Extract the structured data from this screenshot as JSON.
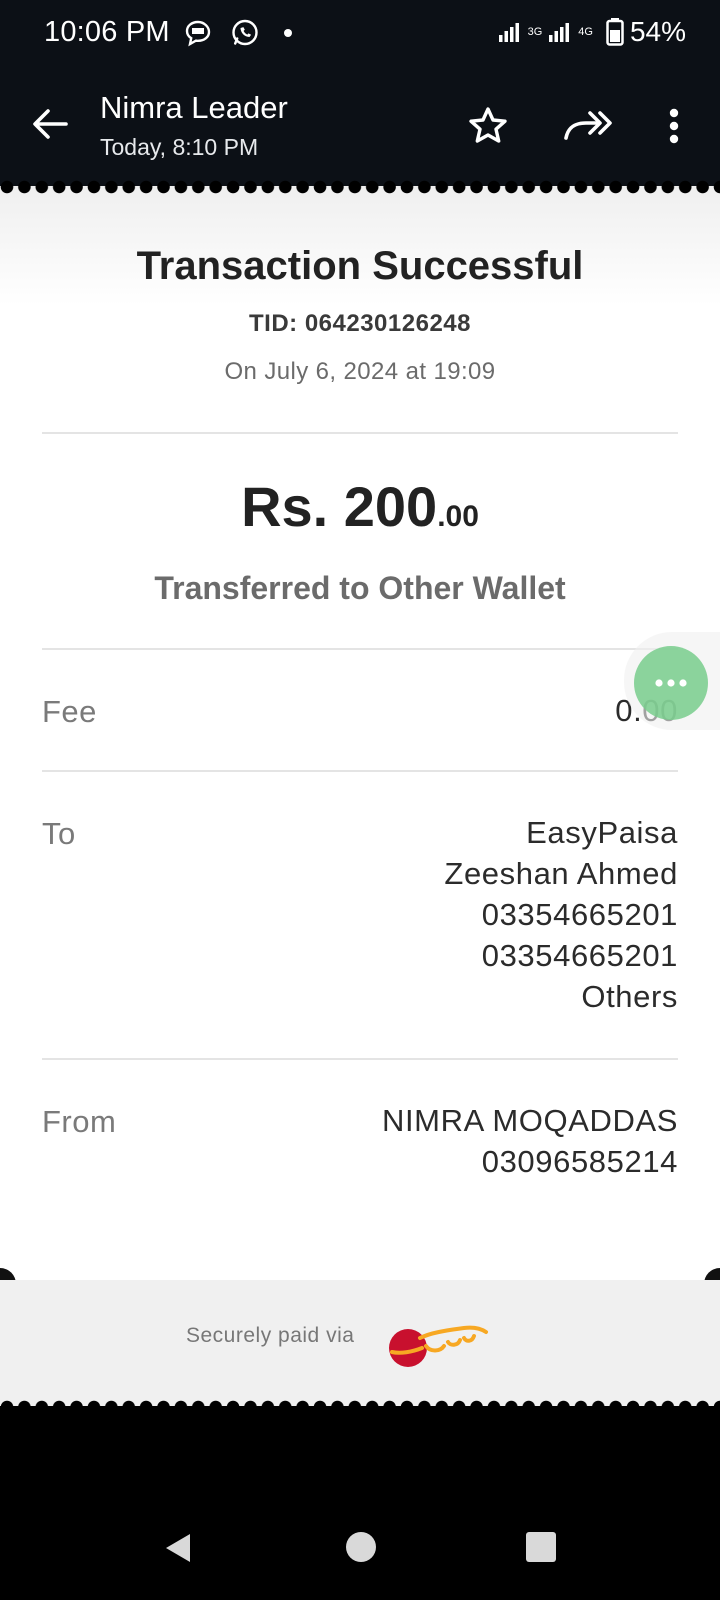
{
  "status_bar": {
    "time": "10:06 PM",
    "network_3g": "3G",
    "network_4g": "4G",
    "battery": "54%"
  },
  "app_bar": {
    "title": "Nimra Leader",
    "subtitle": "Today, 8:10 PM"
  },
  "receipt": {
    "title": "Transaction Successful",
    "tid": "TID: 064230126248",
    "date": "On July 6, 2024 at 19:09",
    "amount_main": "Rs. 200",
    "amount_decimal": ".00",
    "description": "Transferred to Other Wallet",
    "fee": {
      "label": "Fee",
      "value": "0.00"
    },
    "to": {
      "label": "To",
      "lines": [
        "EasyPaisa",
        "Zeeshan Ahmed",
        "03354665201",
        "03354665201",
        "Others"
      ]
    },
    "from": {
      "label": "From",
      "lines": [
        "NIMRA MOQADDAS",
        "03096585214"
      ]
    },
    "footer": {
      "secure_text": "Securely paid via",
      "logo_text": "JazzCash"
    }
  },
  "colors": {
    "header_bg": "#0c1016",
    "fab": "#78cd8c",
    "jazz_red": "#c8102e",
    "jazz_orange": "#f7a823"
  }
}
